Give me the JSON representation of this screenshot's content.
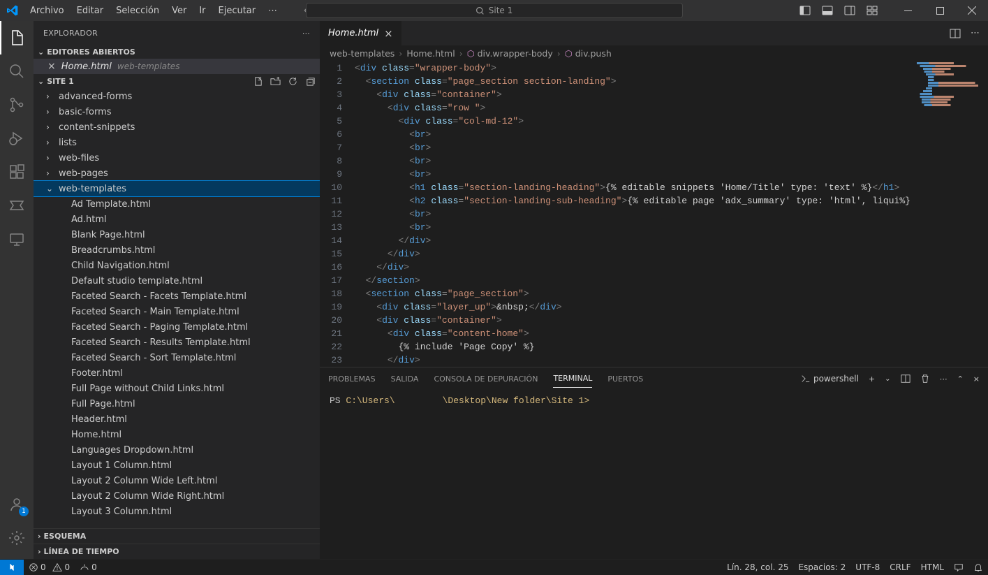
{
  "title_search": "Site 1",
  "menu": {
    "archivo": "Archivo",
    "editar": "Editar",
    "seleccion": "Selección",
    "ver": "Ver",
    "ir": "Ir",
    "ejecutar": "Ejecutar"
  },
  "explorer": {
    "title": "EXPLORADOR",
    "open_editors": "EDITORES ABIERTOS",
    "open_file": "Home.html",
    "open_file_path": "web-templates",
    "project": "SITE 1",
    "folders": [
      {
        "name": "advanced-forms"
      },
      {
        "name": "basic-forms"
      },
      {
        "name": "content-snippets"
      },
      {
        "name": "lists"
      },
      {
        "name": "web-files"
      },
      {
        "name": "web-pages"
      },
      {
        "name": "web-templates",
        "expanded": true,
        "children": [
          "Ad Template.html",
          "Ad.html",
          "Blank Page.html",
          "Breadcrumbs.html",
          "Child Navigation.html",
          "Default studio template.html",
          "Faceted Search - Facets Template.html",
          "Faceted Search - Main Template.html",
          "Faceted Search - Paging Template.html",
          "Faceted Search - Results Template.html",
          "Faceted Search - Sort Template.html",
          "Footer.html",
          "Full Page without Child Links.html",
          "Full Page.html",
          "Header.html",
          "Home.html",
          "Languages Dropdown.html",
          "Layout 1 Column.html",
          "Layout 2 Column Wide Left.html",
          "Layout 2 Column Wide Right.html",
          "Layout 3 Column.html"
        ]
      }
    ],
    "esquema": "ESQUEMA",
    "linea": "LÍNEA DE TIEMPO"
  },
  "tab": {
    "name": "Home.html"
  },
  "breadcrumb": {
    "c1": "web-templates",
    "c2": "Home.html",
    "c3": "div.wrapper-body",
    "c4": "div.push"
  },
  "code": {
    "lines": [
      "<div class=\"wrapper-body\">",
      "  <section class=\"page_section section-landing\">",
      "    <div class=\"container\">",
      "      <div class=\"row \">",
      "        <div class=\"col-md-12\">",
      "          <br>",
      "          <br>",
      "          <br>",
      "          <br>",
      "          <h1 class=\"section-landing-heading\">{% editable snippets 'Home/Title' type: 'text' %}</h1>",
      "          <h2 class=\"section-landing-sub-heading\">{% editable page 'adx_summary' type: 'html', liqui",
      "          <br>",
      "          <br>",
      "        </div>",
      "      </div>",
      "    </div>",
      "  </section>",
      "",
      "  <section class=\"page_section\">",
      "    <div class=\"layer_up\">&nbsp;</div>",
      "    <div class=\"container\">",
      "      <div class=\"content-home\">",
      "        {% include 'Page Copy' %}",
      "      </div>"
    ]
  },
  "panel": {
    "tabs": {
      "problemas": "PROBLEMAS",
      "salida": "SALIDA",
      "consola": "CONSOLA DE DEPURACIÓN",
      "terminal": "TERMINAL",
      "puertos": "PUERTOS"
    },
    "shell": "powershell",
    "prompt_prefix": "PS ",
    "prompt_path": "C:\\Users\\",
    "prompt_mid": "",
    "prompt_suffix": "\\Desktop\\New folder\\Site 1>"
  },
  "status": {
    "errors": "0",
    "warnings": "0",
    "ports": "0",
    "pos": "Lín. 28, col. 25",
    "spaces": "Espacios: 2",
    "enc": "UTF-8",
    "eol": "CRLF",
    "lang": "HTML"
  }
}
